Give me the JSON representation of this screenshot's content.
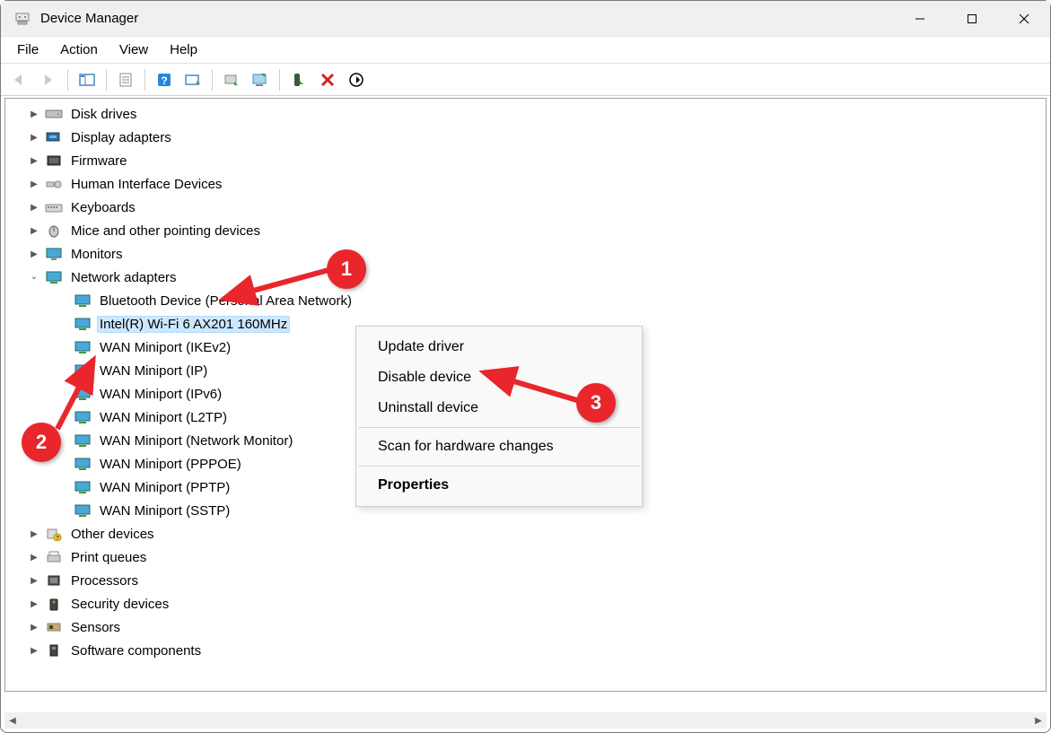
{
  "window": {
    "title": "Device Manager"
  },
  "menus": {
    "file": "File",
    "action": "Action",
    "view": "View",
    "help": "Help"
  },
  "tree": {
    "disk_drives": "Disk drives",
    "display_adapters": "Display adapters",
    "firmware": "Firmware",
    "hid": "Human Interface Devices",
    "keyboards": "Keyboards",
    "mice": "Mice and other pointing devices",
    "monitors": "Monitors",
    "network_adapters": "Network adapters",
    "other_devices": "Other devices",
    "print_queues": "Print queues",
    "processors": "Processors",
    "security_devices": "Security devices",
    "sensors": "Sensors",
    "software_components": "Software components"
  },
  "network_children": {
    "bt": "Bluetooth Device (Personal Area Network)",
    "intel": "Intel(R) Wi-Fi 6 AX201 160MHz",
    "ikev2": "WAN Miniport (IKEv2)",
    "ip": "WAN Miniport (IP)",
    "ipv6": "WAN Miniport (IPv6)",
    "l2tp": "WAN Miniport (L2TP)",
    "netmon": "WAN Miniport (Network Monitor)",
    "pppoe": "WAN Miniport (PPPOE)",
    "pptp": "WAN Miniport (PPTP)",
    "sstp": "WAN Miniport (SSTP)"
  },
  "context": {
    "update": "Update driver",
    "disable": "Disable device",
    "uninstall": "Uninstall device",
    "scan": "Scan for hardware changes",
    "properties": "Properties"
  },
  "badges": {
    "one": "1",
    "two": "2",
    "three": "3"
  }
}
